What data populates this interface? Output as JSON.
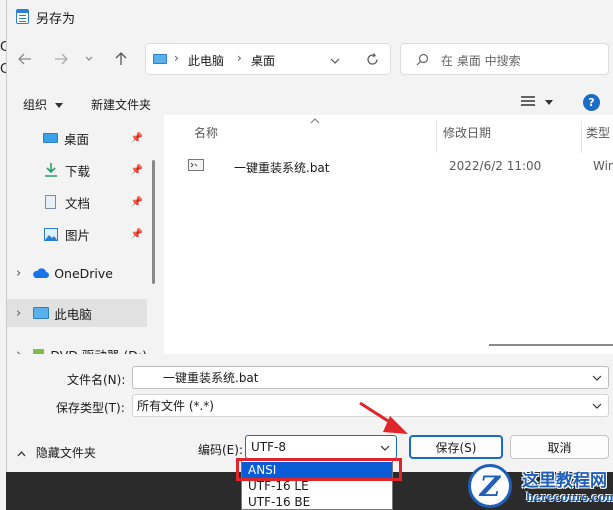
{
  "background": {
    "letters": [
      "C",
      "C"
    ]
  },
  "window": {
    "title": "另存为"
  },
  "nav": {
    "back_icon": "arrow-left-icon",
    "forward_icon": "arrow-right-icon",
    "recent_icon": "chevron-down-icon",
    "up_icon": "arrow-up-icon"
  },
  "address": {
    "crumbs": [
      "此电脑",
      "桌面"
    ],
    "separator": "›"
  },
  "search": {
    "placeholder": "在 桌面 中搜索"
  },
  "toolbar": {
    "organize": "组织",
    "new_folder": "新建文件夹"
  },
  "sidebar": {
    "items": [
      {
        "label": "桌面",
        "icon": "desktop-icon",
        "pinned": true
      },
      {
        "label": "下载",
        "icon": "download-icon",
        "pinned": true
      },
      {
        "label": "文档",
        "icon": "document-icon",
        "pinned": true
      },
      {
        "label": "图片",
        "icon": "picture-icon",
        "pinned": true
      },
      {
        "label": "OneDrive",
        "icon": "cloud-icon",
        "expand": "›"
      },
      {
        "label": "此电脑",
        "icon": "computer-icon",
        "expand": "›"
      },
      {
        "label": "DVD 驱动器 (D:)",
        "icon": "dvd-icon",
        "expand": "›"
      }
    ]
  },
  "columns": {
    "name": "名称",
    "date": "修改日期",
    "type": "类型"
  },
  "files": [
    {
      "name": "一键重装系统.bat",
      "date": "2022/6/2 11:00",
      "type": "Wind"
    }
  ],
  "form": {
    "filename_label": "文件名(N):",
    "filename_value": "一键重装系统.bat",
    "type_label": "保存类型(T):",
    "type_value": "所有文件 (*.*)",
    "hide_folders": "隐藏文件夹",
    "encoding_label": "编码(E):",
    "encoding_value": "UTF-8",
    "save": "保存(S)",
    "cancel": "取消"
  },
  "encoding_options": [
    "ANSI",
    "UTF-16 LE",
    "UTF-16 BE"
  ],
  "watermark": {
    "title": "这里教程网",
    "url": "herecours.com"
  },
  "colors": {
    "accent": "#1a6cc4",
    "selected_option": "#0a5bd6",
    "annotation": "#e0262b"
  }
}
